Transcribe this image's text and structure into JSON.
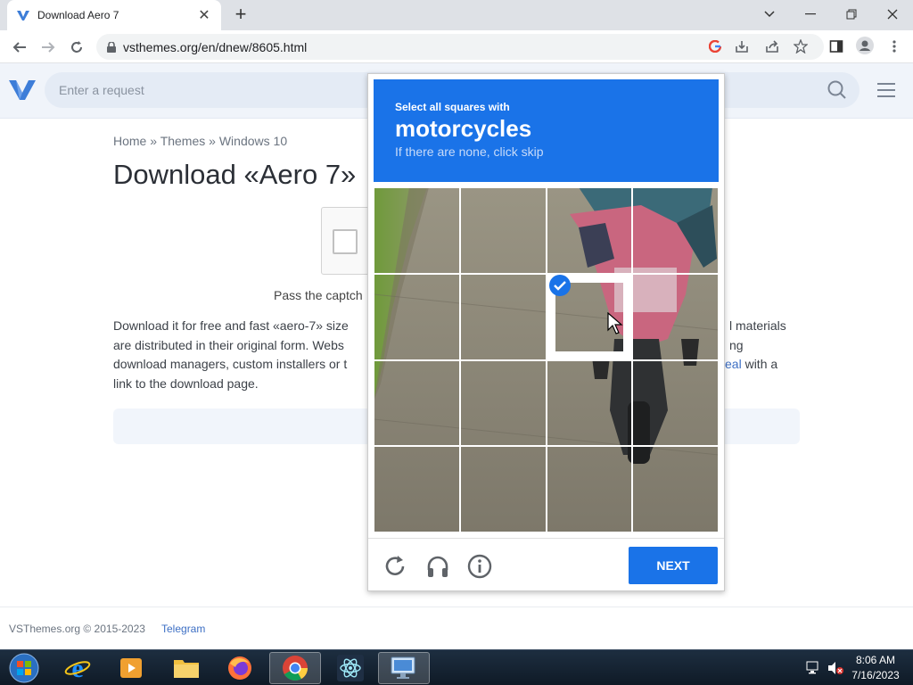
{
  "browser": {
    "tab_title": "Download Aero 7",
    "url": "vsthemes.org/en/dnew/8605.html"
  },
  "site": {
    "search_placeholder": "Enter a request",
    "breadcrumb": {
      "home": "Home",
      "sep1": "»",
      "themes": "Themes",
      "sep2": "»",
      "windows": "Windows 10"
    },
    "page_title": "Download «Aero 7»",
    "pass_captcha": "Pass the captch",
    "para": {
      "line1_left": "Download it for free and fast «aero-7» size",
      "line1_right": "l materials",
      "line2_left": "are distributed in their original form. Webs",
      "line2_right": "ng",
      "line3_left": "download managers, custom installers or t",
      "line3_link": "eal",
      "line3_right": " with a",
      "line4": "link to the download page."
    },
    "footer": {
      "copyright": "VSThemes.org © 2015-2023",
      "telegram": "Telegram"
    }
  },
  "captcha": {
    "instruction": "Select all squares with",
    "target": "motorcycles",
    "hint": "If there are none, click skip",
    "selected_cells": [
      6
    ],
    "next_label": "NEXT",
    "accent": "#1a73e8"
  },
  "taskbar": {
    "apps": [
      "start-orb",
      "internet-explorer",
      "media-player",
      "file-explorer",
      "firefox",
      "chrome",
      "electron-app",
      "remote-desktop"
    ],
    "active": "chrome",
    "time": "8:06 AM",
    "date": "7/16/2023"
  }
}
